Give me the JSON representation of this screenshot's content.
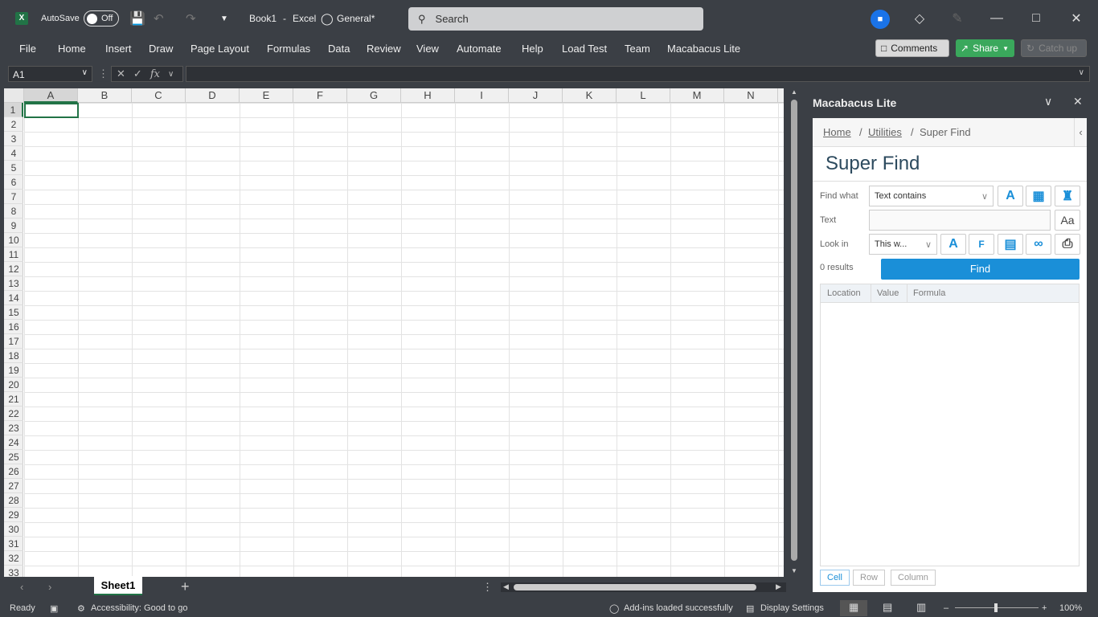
{
  "titlebar": {
    "autosave_label": "AutoSave",
    "autosave_state": "Off",
    "doc_title": "Book1",
    "sep": "-",
    "app_name": "Excel",
    "sensitivity": "General*",
    "search_placeholder": "Search"
  },
  "menu": {
    "items": [
      "File",
      "Home",
      "Insert",
      "Draw",
      "Page Layout",
      "Formulas",
      "Data",
      "Review",
      "View",
      "Automate",
      "Help",
      "Load Test",
      "Team",
      "Macabacus Lite"
    ],
    "comments": "Comments",
    "share": "Share",
    "catchup": "Catch up"
  },
  "formula_bar": {
    "name_box": "A1",
    "fx": "fx",
    "formula": ""
  },
  "sheet": {
    "columns": [
      "A",
      "B",
      "C",
      "D",
      "E",
      "F",
      "G",
      "H",
      "I",
      "J",
      "K",
      "L",
      "M",
      "N"
    ],
    "rows": [
      "1",
      "2",
      "3",
      "4",
      "5",
      "6",
      "7",
      "8",
      "9",
      "10",
      "11",
      "12",
      "13",
      "14",
      "15",
      "16",
      "17",
      "18",
      "19",
      "20",
      "21",
      "22",
      "23",
      "24",
      "25",
      "26",
      "27",
      "28",
      "29",
      "30",
      "31",
      "32",
      "33"
    ],
    "tab": "Sheet1"
  },
  "status": {
    "ready": "Ready",
    "accessibility": "Accessibility: Good to go",
    "addins": "Add-ins loaded successfully",
    "display": "Display Settings",
    "zoom": "100%"
  },
  "pane": {
    "title": "Macabacus Lite",
    "crumb_home": "Home",
    "crumb_sep": "/",
    "crumb_utilities": "Utilities",
    "crumb_current": "Super Find",
    "heading": "Super Find",
    "find_what_label": "Find what",
    "find_what_value": "Text contains",
    "text_label": "Text",
    "text_value": "",
    "look_in_label": "Look in",
    "look_in_value": "This w...",
    "results": "0 results",
    "find_button": "Find",
    "columns": [
      "Location",
      "Value",
      "Formula"
    ],
    "filters": [
      "Cell",
      "Row",
      "Column"
    ],
    "aa_label": "Aa",
    "a_label": "A",
    "f_label": "F"
  },
  "colors": {
    "accent": "#1a8fd8",
    "excel_green": "#217346"
  }
}
